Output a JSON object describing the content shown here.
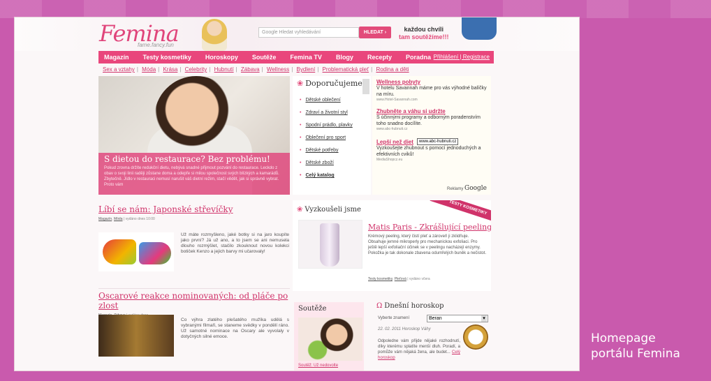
{
  "caption": {
    "line1": "Homepage",
    "line2": "portálu Femina"
  },
  "header": {
    "logo": "Femina",
    "logo_sub": "fame.fancy.fun",
    "search_placeholder": "Google  Hledat vyhledávání",
    "search_button": "HLEDAT ›",
    "promo_line1": "každou chvíli",
    "promo_line2": "tam soutěžíme!!!"
  },
  "nav": {
    "items": [
      "Magazín",
      "Testy kosmetiky",
      "Horoskopy",
      "Soutěže",
      "Femina TV",
      "Blogy",
      "Recepty",
      "Poradna"
    ],
    "login": "Přihlášení | Registrace"
  },
  "subnav": [
    "Sex a vztahy",
    "Móda",
    "Krása",
    "Celebrity",
    "Hubnutí",
    "Zábava",
    "Wellness",
    "Bydlení",
    "Problematická pleť",
    "Rodina a děti"
  ],
  "hero": {
    "title": "S dietou do restaurace? Bez problému!",
    "text": "Pokud zrovna držíte redukční dietu, nebývá snadné přijmout pozvání do restaurace. Leckdo z obav o svoji linii raději zůstane doma a odepře si milou společnost svých blízkých a kamarádů. Zbytečně. Jídlo v restauraci nemusí narušit váš dietní režim, stačí vědět, jak si správně vybrat. Proto vám"
  },
  "recommend": {
    "heading": "Doporučujeme",
    "items": [
      "Dětské oblečení",
      "Zdraví a životní styl",
      "Spodní prádlo, plavky",
      "Oblečení pro sport",
      "Dětské potřeby",
      "Dětské zboží",
      "Celý katalog"
    ]
  },
  "ads": [
    {
      "title": "Wellness pobyty",
      "desc": "V hotelu Savannah máme pro vás výhodné balíčky na míru.",
      "url": "www.Hotel-Savannah.com"
    },
    {
      "title": "Zhubněte a váhu si udržte",
      "desc": "S účinnými programy a odborným poradenstvím toho snadno docílíte.",
      "url": "www.abc-hubnuti.cz"
    },
    {
      "title": "Lepší než diet",
      "desc": "Vyzkoušejte zhubnout s pomocí jednoduchých a efektivních cviků!",
      "url": "MediaShopcz.eu"
    }
  ],
  "ads_tooltip": "www.abc-hubnuti.cz",
  "ads_footer": {
    "label": "Reklamy",
    "brand": "Google"
  },
  "article1": {
    "title": "Líbí se nám: Japonské střevíčky",
    "cat1": "Magazín",
    "cat2": "Móda",
    "time": "vydáno dnes 10:00",
    "body": "Už máte rozmyšleno, jaké botky si na jaro koupíte jako první? Já už ano, a to jsem se ani nemusela dlouho rozmýšlet, stačilo zkouknout novou kolekci botiček Kenzo a jejich barvy mi učarovaly!"
  },
  "article2": {
    "title": "Oscarové reakce nominovaných: od pláče po zlost",
    "cat1": "Magazín",
    "cat2": "Zábava",
    "time": "vydáno dnes",
    "body": "Co výhra zlatého plešatého mužíka udělá s vybranými filmaři, se staneme svědky v pondělí ráno. Už samotné nominace na Oscary ale vyvolaly v dotyčných silné emoce."
  },
  "tested": {
    "heading": "Vyzkoušeli jsme",
    "ribbon": "TESTY KOSMETIKY",
    "product_title": "Matis Paris - Zkrášlující peeling",
    "body": "Krémový peeling, který čistí pleť a zároveň ji zklidňuje. Obsahuje jemné mikroperly pro mechanickou exfoliaci. Pro ještě lepší exfoliační účinek se v peelingu nacházejí enzymy. Pokožka je tak dokonale zbavena odumřelých buněk a nečistot.",
    "cat1": "Testy kosmetiky",
    "cat2": "Pleťová",
    "time": "vydáno včera"
  },
  "contests": {
    "heading": "Soutěže",
    "link": "Soutěž: Už nedovolte"
  },
  "horoscope": {
    "heading": "Dnešní horoskop",
    "label": "Vyberte znamení",
    "selected": "Beran",
    "date": "22. 02. 2011 Horoskop Váhy",
    "body": "Odpoledne vám přijde nějaké rozhodnutí, díky kterému splatíte menší dluh. Poradí, a pomůže vám nějaká žena, ale budet...",
    "more": "Celý horoskop"
  }
}
